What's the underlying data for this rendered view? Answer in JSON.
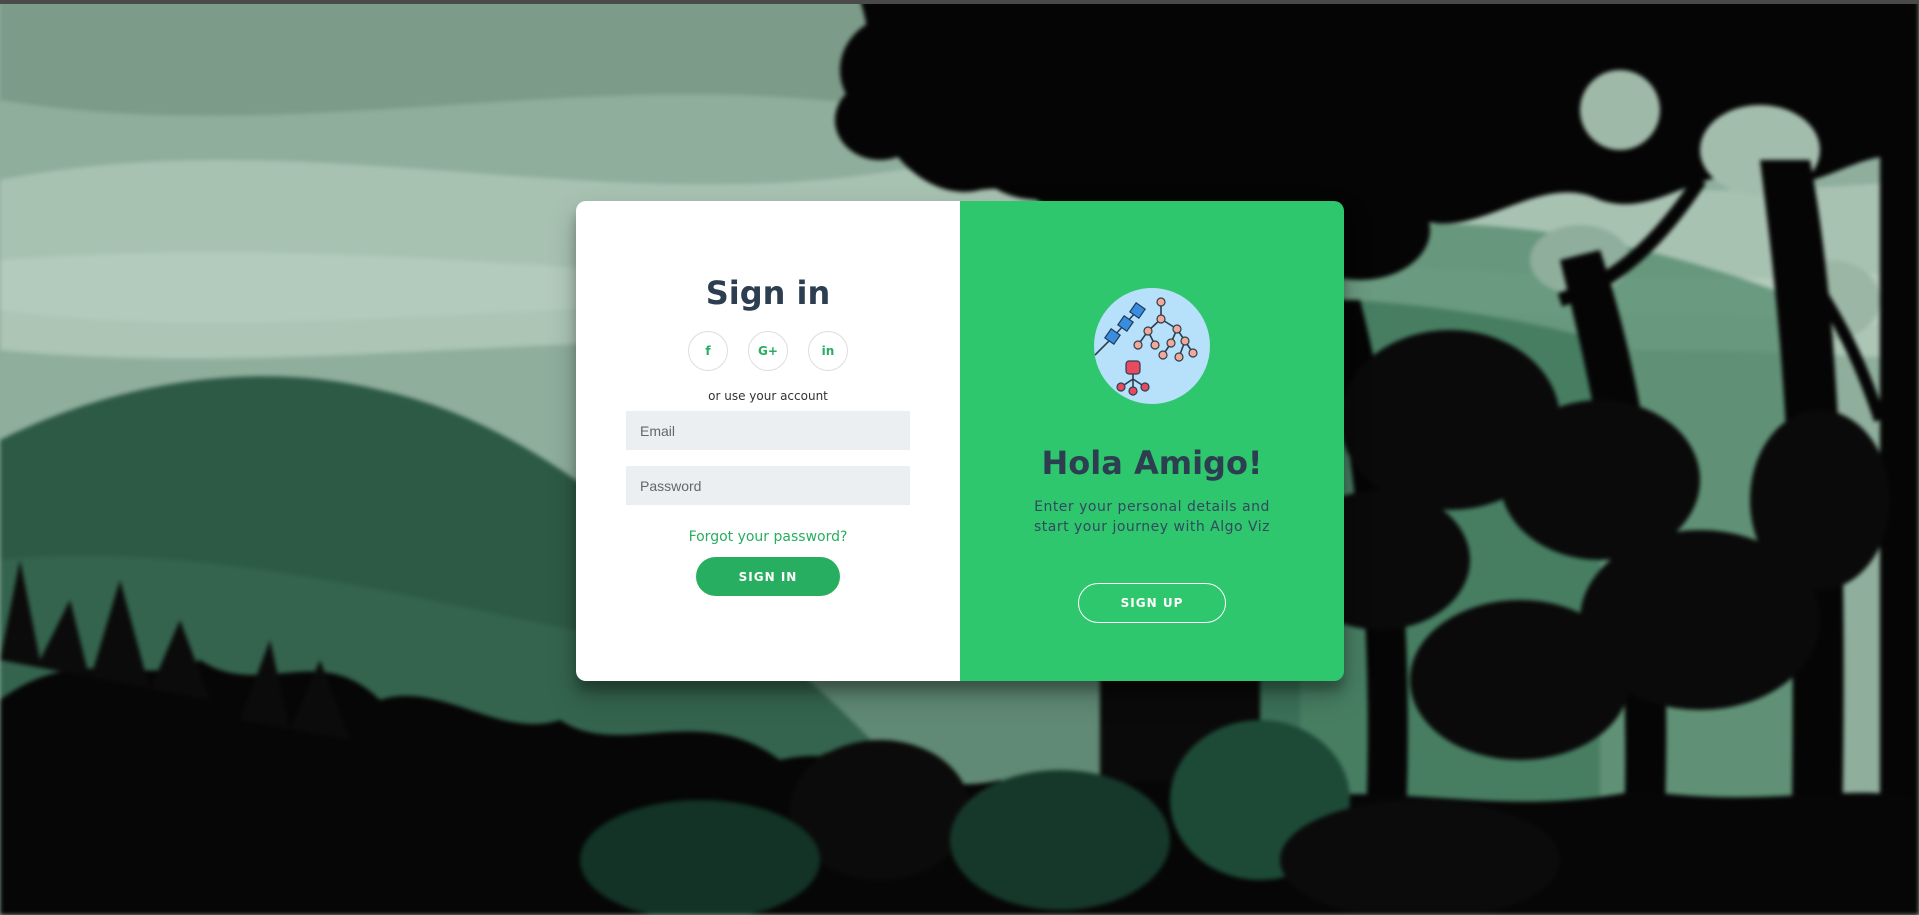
{
  "signin": {
    "title": "Sign in",
    "social": [
      {
        "icon": "facebook-icon",
        "glyph": "f"
      },
      {
        "icon": "google-plus-icon",
        "glyph": "G+"
      },
      {
        "icon": "linkedin-icon",
        "glyph": "in"
      }
    ],
    "hint": "or use your account",
    "email_placeholder": "Email",
    "password_placeholder": "Password",
    "forgot": "Forgot your password?",
    "button": "SIGN IN"
  },
  "overlay": {
    "title": "Hola Amigo!",
    "text": "Enter your personal details and start your journey with Algo Viz",
    "button": "SIGN UP"
  },
  "colors": {
    "accent": "#27ae60",
    "overlay_bg": "#2ec76d",
    "heading": "#2c3e50",
    "input_bg": "#eceff1"
  }
}
